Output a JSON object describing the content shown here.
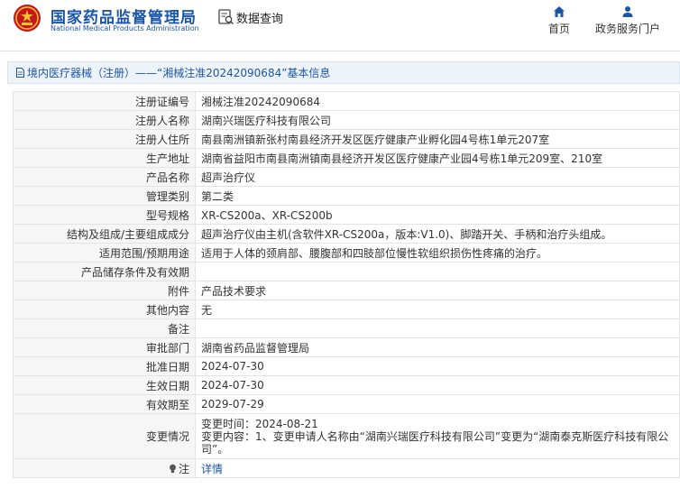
{
  "header": {
    "brand_cn": "国家药品监督管理局",
    "brand_en": "National Medical Products Administration",
    "search_label": "数据查询",
    "nav": [
      {
        "label": "首页",
        "icon": "home-icon"
      },
      {
        "label": "政务服务门户",
        "icon": "user-icon"
      }
    ],
    "brand_color": "#1a56a8"
  },
  "breadcrumb": {
    "category": "境内医疗器械（注册）",
    "separator": "——",
    "record": "“湘械注准20242090684”基本信息"
  },
  "details": [
    {
      "key": "注册证编号",
      "value": "湘械注准20242090684"
    },
    {
      "key": "注册人名称",
      "value": "湖南兴瑞医疗科技有限公司"
    },
    {
      "key": "注册人住所",
      "value": "南县南洲镇新张村南县经济开发区医疗健康产业孵化园4号栋1单元207室"
    },
    {
      "key": "生产地址",
      "value": "湖南省益阳市南县南洲镇南县经济开发区医疗健康产业园4号栋1单元209室、210室"
    },
    {
      "key": "产品名称",
      "value": "超声治疗仪"
    },
    {
      "key": "管理类别",
      "value": "第二类"
    },
    {
      "key": "型号规格",
      "value": "XR-CS200a、XR-CS200b"
    },
    {
      "key": "结构及组成/主要组成成分",
      "value": "超声治疗仪由主机(含软件XR-CS200a，版本:V1.0)、脚踏开关、手柄和治疗头组成。"
    },
    {
      "key": "适用范围/预期用途",
      "value": "适用于人体的颈肩部、腰腹部和四肢部位慢性软组织损伤性疼痛的治疗。"
    },
    {
      "key": "产品储存条件及有效期",
      "value": ""
    },
    {
      "key": "附件",
      "value": "产品技术要求"
    },
    {
      "key": "其他内容",
      "value": "无"
    },
    {
      "key": "备注",
      "value": ""
    },
    {
      "key": "审批部门",
      "value": "湖南省药品监督管理局"
    },
    {
      "key": "批准日期",
      "value": "2024-07-30"
    },
    {
      "key": "生效日期",
      "value": "2024-07-30"
    },
    {
      "key": "有效期至",
      "value": "2029-07-29"
    }
  ],
  "change": {
    "key": "变更情况",
    "line1": "变更时间：2024-08-21",
    "line2": "变更内容：1、变更申请人名称由“湖南兴瑞医疗科技有限公司”变更为“湖南泰克斯医疗科技有限公司”。"
  },
  "note": {
    "key": "注",
    "link": "详情",
    "icon": "bulb-icon"
  }
}
